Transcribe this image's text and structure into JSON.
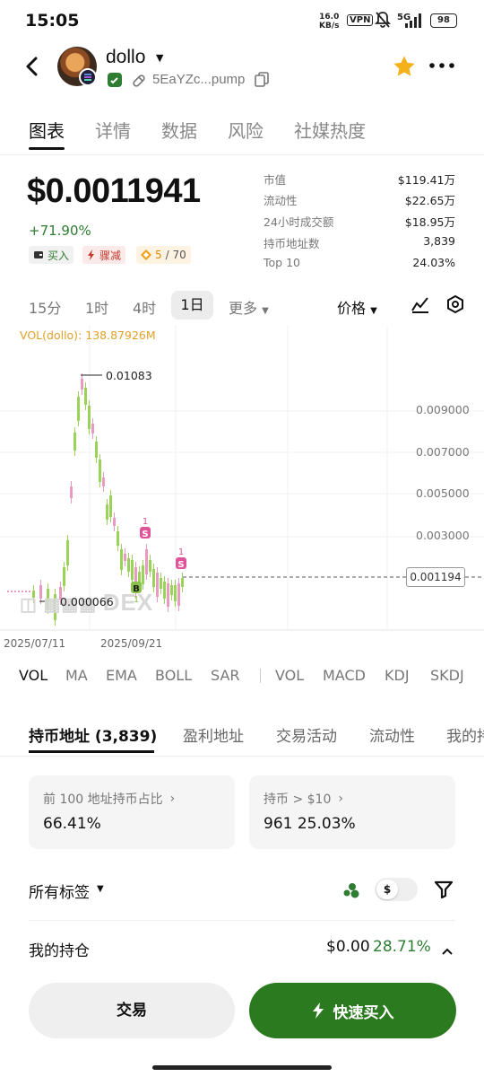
{
  "status_bar": {
    "time": "15:05",
    "net_speed": "16.0",
    "net_unit": "KB/s",
    "vpn": "VPN",
    "signal": "5G",
    "battery": "98"
  },
  "header": {
    "token_name": "dollo",
    "address": "5EaYZc...pump"
  },
  "tabs": [
    {
      "label": "图表"
    },
    {
      "label": "详情"
    },
    {
      "label": "数据"
    },
    {
      "label": "风险"
    },
    {
      "label": "社媒热度"
    }
  ],
  "price": {
    "value": "$0.0011941",
    "change": "+71.90%",
    "chips": {
      "buy": "买入",
      "dump": "骤减",
      "score": "5",
      "score_total": "/ 70"
    }
  },
  "stats": [
    {
      "label": "市值",
      "value": "$119.41万"
    },
    {
      "label": "流动性",
      "value": "$22.65万"
    },
    {
      "label": "24小时成交额",
      "value": "$18.95万"
    },
    {
      "label": "持币地址数",
      "value": "3,839"
    },
    {
      "label": "Top 10",
      "value": "24.03%"
    }
  ],
  "intervals": {
    "items": [
      "15分",
      "1时",
      "4时",
      "1日"
    ],
    "selected": "1日",
    "more": "更多",
    "price_mode": "价格"
  },
  "chart_data": {
    "type": "candlestick",
    "volume_label": "VOL(dollo): 138.87926M",
    "x_labels": [
      "2025/07/11",
      "2025/09/21"
    ],
    "y_ticks": [
      "0.009000",
      "0.007000",
      "0.005000",
      "0.003000"
    ],
    "high_label": "0.01083",
    "low_label": "0.000066",
    "current_price": "0.001194",
    "watermark": "DEX",
    "markers": [
      {
        "type": "S",
        "count": "1"
      },
      {
        "type": "B",
        "count": "1"
      },
      {
        "type": "S",
        "count": "1"
      }
    ],
    "colors": {
      "up": "#9bd35a",
      "down": "#e89ac0"
    }
  },
  "indicators": [
    "VOL",
    "MA",
    "EMA",
    "BOLL",
    "SAR",
    "VOL",
    "MACD",
    "KDJ",
    "SKDJ"
  ],
  "bottom_tabs": [
    "持币地址 (3,839)",
    "盈利地址",
    "交易活动",
    "流动性",
    "我的持"
  ],
  "cards": {
    "top100_title": "前 100 地址持币占比",
    "top100_value": "66.41%",
    "holders_title": "持币 > $10",
    "holders_count": "961",
    "holders_pct": "25.03%"
  },
  "filter": {
    "label": "所有标签",
    "toggle_symbol": "$"
  },
  "holding": {
    "label": "我的持仓",
    "value": "$0.00",
    "pct": "28.71%"
  },
  "actions": {
    "trade": "交易",
    "quick_buy": "快速买入"
  }
}
